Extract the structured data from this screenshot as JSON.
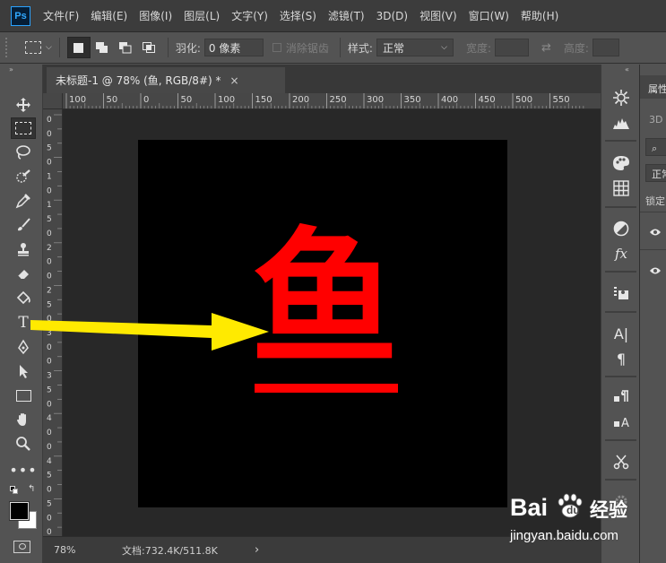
{
  "app": {
    "logo": "Ps"
  },
  "menu": [
    "文件(F)",
    "编辑(E)",
    "图像(I)",
    "图层(L)",
    "文字(Y)",
    "选择(S)",
    "滤镜(T)",
    "3D(D)",
    "视图(V)",
    "窗口(W)",
    "帮助(H)"
  ],
  "options": {
    "feather_label": "羽化:",
    "feather_value": "0 像素",
    "antialias_label": "消除锯齿",
    "style_label": "样式:",
    "style_value": "正常",
    "width_label": "宽度:",
    "height_label": "高度:"
  },
  "document": {
    "tab_title": "未标题-1 @ 78% (鱼, RGB/8#) *",
    "tab_close": "×",
    "canvas_text": "鱼",
    "canvas_text_color": "#ff0000",
    "canvas_background": "#000000"
  },
  "ruler": {
    "top_ticks": [
      "100",
      "50",
      "0",
      "50",
      "100",
      "150",
      "200",
      "250",
      "300",
      "350",
      "400",
      "450",
      "500",
      "550"
    ],
    "left_ticks": [
      "0",
      "0",
      "5",
      "0",
      "1",
      "0",
      "1",
      "5",
      "0",
      "2",
      "0",
      "0",
      "2",
      "5",
      "0",
      "3",
      "0",
      "0",
      "3",
      "5",
      "0",
      "4",
      "0",
      "0",
      "4",
      "5",
      "0",
      "5",
      "0",
      "0"
    ]
  },
  "status": {
    "zoom": "78%",
    "doc_info": "文档:732.4K/511.8K",
    "arrow": "›"
  },
  "props_panel": {
    "tab": "属性",
    "row1": "3D",
    "row2": "正常",
    "row3": "锁定"
  },
  "watermark": {
    "brand": "Bai",
    "brand_suffix": "du",
    "jingyan": "经验",
    "url": "jingyan.baidu.com"
  },
  "colors": {
    "menubar": "#3c3c3c",
    "panel": "#535353",
    "workspace": "#282828",
    "arrow": "#ffea00",
    "text_red": "#ff0000",
    "baidu_blue": "#2932e1",
    "baidu_red": "#de3133"
  }
}
